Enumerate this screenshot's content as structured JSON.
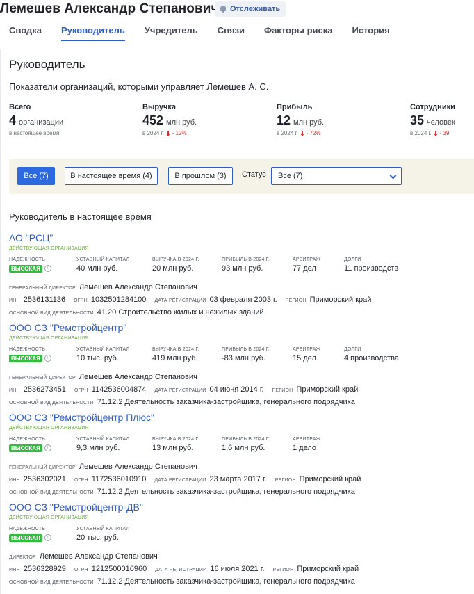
{
  "header": {
    "person_name": "Лемешев Александр Степанович",
    "track_label": "Отслеживать",
    "tabs": [
      {
        "label": "Сводка"
      },
      {
        "label": "Руководитель"
      },
      {
        "label": "Учредитель"
      },
      {
        "label": "Связи"
      },
      {
        "label": "Факторы риска"
      },
      {
        "label": "История"
      }
    ],
    "active_tab": "Руководитель"
  },
  "section": {
    "title": "Руководитель",
    "subheading": "Показатели организаций, которыми управляет Лемешев А. С."
  },
  "metrics": [
    {
      "label": "Всего",
      "value": "4",
      "unit": "организации",
      "note": "в настоящее время",
      "change": ""
    },
    {
      "label": "Выручка",
      "value": "452",
      "unit": "млн руб.",
      "note": "в 2024 г.",
      "change": "- 12%"
    },
    {
      "label": "Прибыль",
      "value": "12",
      "unit": "млн руб.",
      "note": "в 2024 г.",
      "change": "- 72%"
    },
    {
      "label": "Сотрудники",
      "value": "35",
      "unit": "человек",
      "note": "в 2024 г.",
      "change": "- 39"
    }
  ],
  "filters": {
    "buttons": [
      {
        "label": "Все (7)",
        "active": true
      },
      {
        "label": "В настоящее время (4)",
        "active": false
      },
      {
        "label": "В прошлом (3)",
        "active": false
      }
    ],
    "status_label": "Статус",
    "status_value": "Все (7)"
  },
  "list_title": "Руководитель в настоящее время",
  "labels": {
    "reliability": "Надежность",
    "capital": "Уставный капитал",
    "revenue": "Выручка в 2024 г.",
    "profit": "Прибыль в 2024 г.",
    "arbitration": "Арбитраж",
    "debts": "Долги",
    "inn": "ИНН",
    "ogrn": "ОГРН",
    "reg_date": "Дата регистрации",
    "region": "Регион",
    "main_activity": "Основной вид деятельности",
    "reliability_value": "Высокая",
    "status": "Действующая организация",
    "info_glyph": "i"
  },
  "organizations": [
    {
      "name": "АО \"РСЦ\"",
      "capital": "40 млн руб.",
      "revenue": "20 млн руб.",
      "profit": "93 млн руб.",
      "arbitration": "77 дел",
      "debts": "11 производств",
      "director_label": "Генеральный директор",
      "director": "Лемешев Александр Степанович",
      "inn": "2536131136",
      "ogrn": "1032501284100",
      "reg_date": "03 февраля 2003 г.",
      "region": "Приморский край",
      "activity": "41.20 Строительство жилых и нежилых зданий"
    },
    {
      "name": "ООО СЗ \"Ремстройцентр\"",
      "capital": "10 тыс. руб.",
      "revenue": "419 млн руб.",
      "profit": "-83 млн руб.",
      "arbitration": "15 дел",
      "debts": "4 производства",
      "director_label": "Генеральный директор",
      "director": "Лемешев Александр Степанович",
      "inn": "2536273451",
      "ogrn": "1142536004874",
      "reg_date": "04 июня 2014 г.",
      "region": "Приморский край",
      "activity": "71.12.2 Деятельность заказчика-застройщика, генерального подрядчика"
    },
    {
      "name": "ООО СЗ \"Ремстройцентр Плюс\"",
      "capital": "9,3 млн руб.",
      "revenue": "13 млн руб.",
      "profit": "1,6 млн руб.",
      "arbitration": "1 дело",
      "debts": "",
      "director_label": "Генеральный директор",
      "director": "Лемешев Александр Степанович",
      "inn": "2536302021",
      "ogrn": "1172536010910",
      "reg_date": "23 марта 2017 г.",
      "region": "Приморский край",
      "activity": "71.12.2 Деятельность заказчика-застройщика, генерального подрядчика"
    },
    {
      "name": "ООО СЗ \"Ремстройцентр-ДВ\"",
      "capital": "20 тыс. руб.",
      "revenue": "",
      "profit": "",
      "arbitration": "",
      "debts": "",
      "director_label": "Директор",
      "director": "Лемешев Александр Степанович",
      "inn": "2536328929",
      "ogrn": "1212500016960",
      "reg_date": "16 июля 2021 г.",
      "region": "Приморский край",
      "activity": "71.12.2 Деятельность заказчика-застройщика, генерального подрядчика"
    }
  ]
}
